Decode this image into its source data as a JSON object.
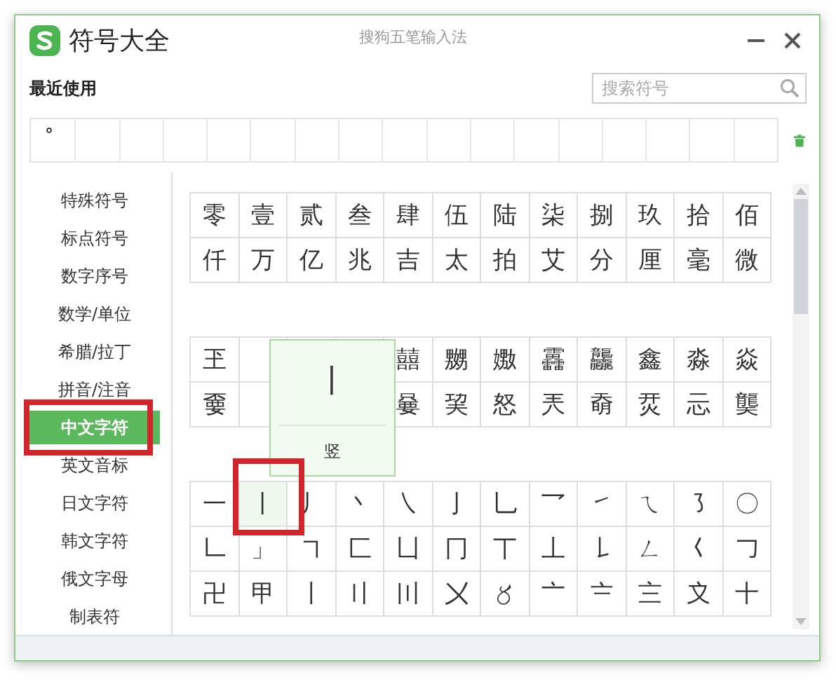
{
  "window": {
    "title": "符号大全",
    "subtitle": "搜狗五笔输入法"
  },
  "recent": {
    "label": "最近使用",
    "items": [
      "°"
    ]
  },
  "search": {
    "placeholder": "搜索符号"
  },
  "sidebar": {
    "items": [
      {
        "label": "特殊符号",
        "selected": false
      },
      {
        "label": "标点符号",
        "selected": false
      },
      {
        "label": "数字序号",
        "selected": false
      },
      {
        "label": "数学/单位",
        "selected": false
      },
      {
        "label": "希腊/拉丁",
        "selected": false
      },
      {
        "label": "拼音/注音",
        "selected": false
      },
      {
        "label": "中文字符",
        "selected": true
      },
      {
        "label": "英文音标",
        "selected": false
      },
      {
        "label": "日文字符",
        "selected": false
      },
      {
        "label": "韩文字符",
        "selected": false
      },
      {
        "label": "俄文字母",
        "selected": false
      },
      {
        "label": "制表符",
        "selected": false
      }
    ]
  },
  "groups": [
    {
      "rows": [
        [
          {
            "char": "零",
            "selected": false
          },
          {
            "char": "壹",
            "selected": false
          },
          {
            "char": "贰",
            "selected": false
          },
          {
            "char": "叁",
            "selected": false
          },
          {
            "char": "肆",
            "selected": false
          },
          {
            "char": "伍",
            "selected": false
          },
          {
            "char": "陆",
            "selected": false
          },
          {
            "char": "柒",
            "selected": false
          },
          {
            "char": "捌",
            "selected": false
          },
          {
            "char": "玖",
            "selected": false
          },
          {
            "char": "拾",
            "selected": false
          },
          {
            "char": "佰",
            "selected": false
          }
        ],
        [
          {
            "char": "仟",
            "selected": false
          },
          {
            "char": "万",
            "selected": false
          },
          {
            "char": "亿",
            "selected": false
          },
          {
            "char": "兆",
            "selected": false
          },
          {
            "char": "吉",
            "selected": false
          },
          {
            "char": "太",
            "selected": false
          },
          {
            "char": "拍",
            "selected": false
          },
          {
            "char": "艾",
            "selected": false
          },
          {
            "char": "分",
            "selected": false
          },
          {
            "char": "厘",
            "selected": false
          },
          {
            "char": "毫",
            "selected": false
          },
          {
            "char": "微",
            "selected": false
          }
        ]
      ]
    },
    {
      "rows": [
        [
          {
            "char": "玊",
            "selected": false
          },
          null,
          null,
          null,
          {
            "char": "囍",
            "selected": false
          },
          {
            "char": "嬲",
            "selected": false
          },
          {
            "char": "嫐",
            "selected": false
          },
          {
            "char": "靐",
            "selected": false
          },
          {
            "char": "龘",
            "selected": false
          },
          {
            "char": "鑫",
            "selected": false
          },
          {
            "char": "淼",
            "selected": false
          },
          {
            "char": "焱",
            "selected": false
          }
        ],
        [
          {
            "char": "嫑",
            "selected": false
          },
          null,
          null,
          null,
          {
            "char": "嘦",
            "selected": false
          },
          {
            "char": "巭",
            "selected": false
          },
          {
            "char": "怒",
            "selected": false
          },
          {
            "char": "兲",
            "selected": false
          },
          {
            "char": "奣",
            "selected": false
          },
          {
            "char": "烎",
            "selected": false
          },
          {
            "char": "忈",
            "selected": false
          },
          {
            "char": "龑",
            "selected": false
          }
        ]
      ]
    },
    {
      "rows": [
        [
          {
            "char": "一",
            "selected": false
          },
          {
            "char": "丨",
            "selected": true
          },
          {
            "char": "丿",
            "selected": false
          },
          {
            "char": "丶",
            "selected": false
          },
          {
            "char": "㇏",
            "selected": false
          },
          {
            "char": "亅",
            "selected": false
          },
          {
            "char": "乚",
            "selected": false
          },
          {
            "char": "乛",
            "selected": false
          },
          {
            "char": "㇀",
            "selected": false
          },
          {
            "char": "ㄟ",
            "selected": false
          },
          {
            "char": "㇌",
            "selected": false
          },
          {
            "char": "〇",
            "selected": false
          }
        ],
        [
          {
            "char": "𠃊",
            "selected": false
          },
          {
            "char": "」",
            "selected": false
          },
          {
            "char": "㇕",
            "selected": false
          },
          {
            "char": "匚",
            "selected": false
          },
          {
            "char": "凵",
            "selected": false
          },
          {
            "char": "冂",
            "selected": false
          },
          {
            "char": "丅",
            "selected": false
          },
          {
            "char": "丄",
            "selected": false
          },
          {
            "char": "𠄌",
            "selected": false
          },
          {
            "char": "ㄥ",
            "selected": false
          },
          {
            "char": "𡿨",
            "selected": false
          },
          {
            "char": "𠃌",
            "selected": false
          }
        ],
        [
          {
            "char": "卍",
            "selected": false
          },
          {
            "char": "甲",
            "selected": false
          },
          {
            "char": "〡",
            "selected": false
          },
          {
            "char": "〢",
            "selected": false
          },
          {
            "char": "〣",
            "selected": false
          },
          {
            "char": "〤",
            "selected": false
          },
          {
            "char": "〥",
            "selected": false
          },
          {
            "char": "〦",
            "selected": false
          },
          {
            "char": "〧",
            "selected": false
          },
          {
            "char": "〨",
            "selected": false
          },
          {
            "char": "〩",
            "selected": false
          },
          {
            "char": "十",
            "selected": false
          }
        ]
      ]
    }
  ],
  "tooltip": {
    "symbol": "丨",
    "name": "竖"
  }
}
